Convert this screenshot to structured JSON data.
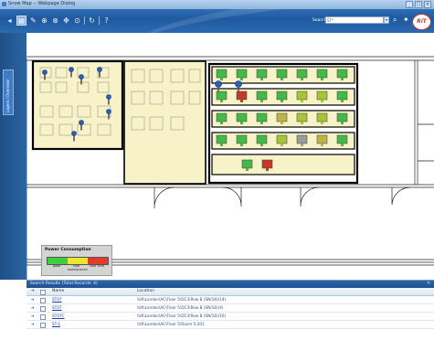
{
  "window": {
    "title": "Snow Map -- Webpage Dialog"
  },
  "toolbar": {
    "icons": [
      "map-icon",
      "pencil-icon",
      "link-icon",
      "link-icon",
      "move-icon",
      "refresh-icon",
      "help-icon"
    ],
    "search_label": "Search:",
    "search_value": "ST*",
    "logo_text": "RiT"
  },
  "side_panel": {
    "tab_label": "Layers / Overview"
  },
  "legend": {
    "title": "Power Consumption",
    "labels": [
      "good",
      "near maintenance",
      "near limit"
    ],
    "colors": [
      "#3ecf3e",
      "#e8e830",
      "#e63a2a"
    ]
  },
  "results": {
    "header": "Search Results (Total Records: 4)",
    "columns": {
      "name": "Name",
      "location": "Location"
    },
    "rows": [
      {
        "name": "ST07",
        "location": "\\UK\\London\\AC\\Floor 5\\DC3\\Row B (SN/18)(14)"
      },
      {
        "name": "ST07",
        "location": "\\UK\\London\\AC\\Floor 5\\DC3\\Row B (SN/18)(4)"
      },
      {
        "name": "ST07C",
        "location": "\\UK\\London\\AC\\Floor 5\\DC3\\Row B (SN/18)(16)"
      },
      {
        "name": "ST-1",
        "location": "\\UK\\London\\AC\\Floor 5\\Room 5-201"
      }
    ]
  },
  "rack_colors": {
    "green": "#44b84a",
    "yellow_green": "#a8c23a",
    "khaki": "#c0b24a",
    "red": "#c8372d",
    "grey": "#9a9a9a"
  }
}
